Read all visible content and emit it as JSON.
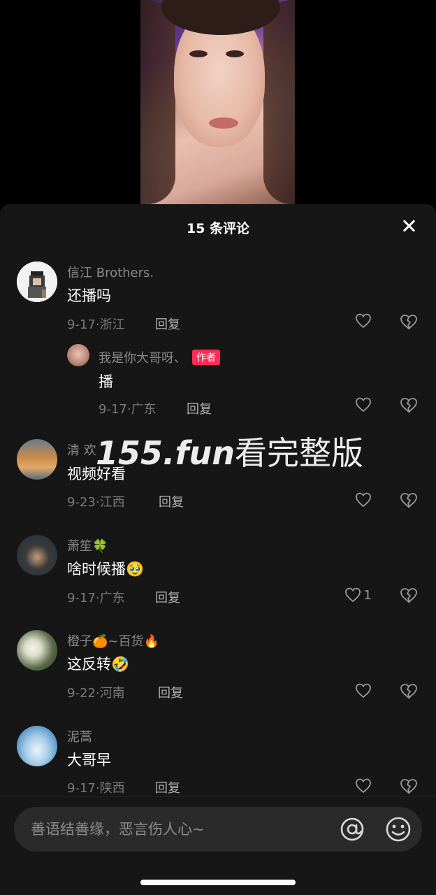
{
  "sheet": {
    "title": "15 条评论"
  },
  "watermark": {
    "part_a": "155.fun",
    "part_b": "看完整版"
  },
  "comments": [
    {
      "username": "信江 Brothers.",
      "text": "还播吗",
      "date": "9-17",
      "location": "浙江",
      "reply": "回复",
      "likes": ""
    },
    {
      "username": "我是你大哥呀、",
      "badge": "作者",
      "text": "播",
      "date": "9-17",
      "location": "广东",
      "reply": "回复",
      "likes": ""
    },
    {
      "username": "清 欢",
      "text": "视频好看",
      "date": "9-23",
      "location": "江西",
      "reply": "回复",
      "likes": ""
    },
    {
      "username": "萧笙🍀",
      "text": "啥时候播🥹",
      "date": "9-17",
      "location": "广东",
      "reply": "回复",
      "likes": "1"
    },
    {
      "username": "橙子🍊~百货🔥",
      "text": "这反转🤣",
      "date": "9-22",
      "location": "河南",
      "reply": "回复",
      "likes": ""
    },
    {
      "username": "泥蒿",
      "text": "大哥早",
      "date": "9-17",
      "location": "陕西",
      "reply": "回复",
      "likes": ""
    }
  ],
  "input": {
    "placeholder": "善语结善缘，恶言伤人心~"
  },
  "icons": {
    "close": "close-icon",
    "at": "at-icon",
    "emoji": "emoji-icon",
    "like": "heart-icon",
    "dislike": "broken-heart-icon"
  },
  "colors": {
    "author_badge": "#fe2c55",
    "sheet_bg": "#161616"
  }
}
